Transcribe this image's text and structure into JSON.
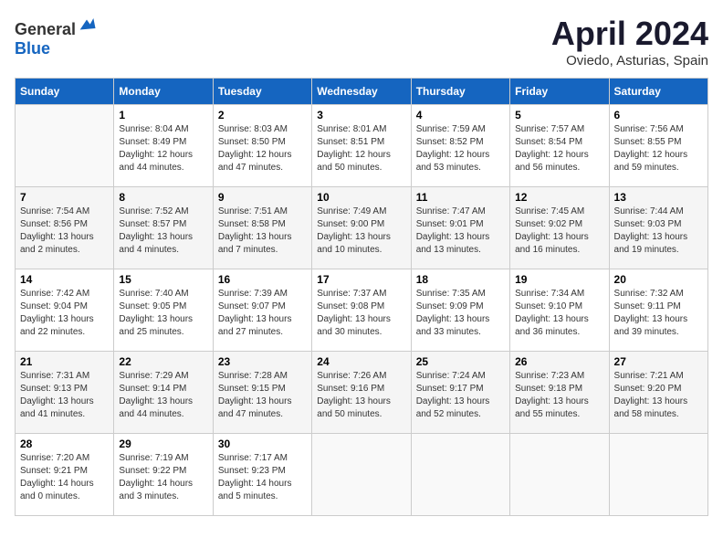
{
  "header": {
    "logo_general": "General",
    "logo_blue": "Blue",
    "title": "April 2024",
    "subtitle": "Oviedo, Asturias, Spain"
  },
  "columns": [
    "Sunday",
    "Monday",
    "Tuesday",
    "Wednesday",
    "Thursday",
    "Friday",
    "Saturday"
  ],
  "weeks": [
    [
      {
        "day": "",
        "info": ""
      },
      {
        "day": "1",
        "info": "Sunrise: 8:04 AM\nSunset: 8:49 PM\nDaylight: 12 hours\nand 44 minutes."
      },
      {
        "day": "2",
        "info": "Sunrise: 8:03 AM\nSunset: 8:50 PM\nDaylight: 12 hours\nand 47 minutes."
      },
      {
        "day": "3",
        "info": "Sunrise: 8:01 AM\nSunset: 8:51 PM\nDaylight: 12 hours\nand 50 minutes."
      },
      {
        "day": "4",
        "info": "Sunrise: 7:59 AM\nSunset: 8:52 PM\nDaylight: 12 hours\nand 53 minutes."
      },
      {
        "day": "5",
        "info": "Sunrise: 7:57 AM\nSunset: 8:54 PM\nDaylight: 12 hours\nand 56 minutes."
      },
      {
        "day": "6",
        "info": "Sunrise: 7:56 AM\nSunset: 8:55 PM\nDaylight: 12 hours\nand 59 minutes."
      }
    ],
    [
      {
        "day": "7",
        "info": "Sunrise: 7:54 AM\nSunset: 8:56 PM\nDaylight: 13 hours\nand 2 minutes."
      },
      {
        "day": "8",
        "info": "Sunrise: 7:52 AM\nSunset: 8:57 PM\nDaylight: 13 hours\nand 4 minutes."
      },
      {
        "day": "9",
        "info": "Sunrise: 7:51 AM\nSunset: 8:58 PM\nDaylight: 13 hours\nand 7 minutes."
      },
      {
        "day": "10",
        "info": "Sunrise: 7:49 AM\nSunset: 9:00 PM\nDaylight: 13 hours\nand 10 minutes."
      },
      {
        "day": "11",
        "info": "Sunrise: 7:47 AM\nSunset: 9:01 PM\nDaylight: 13 hours\nand 13 minutes."
      },
      {
        "day": "12",
        "info": "Sunrise: 7:45 AM\nSunset: 9:02 PM\nDaylight: 13 hours\nand 16 minutes."
      },
      {
        "day": "13",
        "info": "Sunrise: 7:44 AM\nSunset: 9:03 PM\nDaylight: 13 hours\nand 19 minutes."
      }
    ],
    [
      {
        "day": "14",
        "info": "Sunrise: 7:42 AM\nSunset: 9:04 PM\nDaylight: 13 hours\nand 22 minutes."
      },
      {
        "day": "15",
        "info": "Sunrise: 7:40 AM\nSunset: 9:05 PM\nDaylight: 13 hours\nand 25 minutes."
      },
      {
        "day": "16",
        "info": "Sunrise: 7:39 AM\nSunset: 9:07 PM\nDaylight: 13 hours\nand 27 minutes."
      },
      {
        "day": "17",
        "info": "Sunrise: 7:37 AM\nSunset: 9:08 PM\nDaylight: 13 hours\nand 30 minutes."
      },
      {
        "day": "18",
        "info": "Sunrise: 7:35 AM\nSunset: 9:09 PM\nDaylight: 13 hours\nand 33 minutes."
      },
      {
        "day": "19",
        "info": "Sunrise: 7:34 AM\nSunset: 9:10 PM\nDaylight: 13 hours\nand 36 minutes."
      },
      {
        "day": "20",
        "info": "Sunrise: 7:32 AM\nSunset: 9:11 PM\nDaylight: 13 hours\nand 39 minutes."
      }
    ],
    [
      {
        "day": "21",
        "info": "Sunrise: 7:31 AM\nSunset: 9:13 PM\nDaylight: 13 hours\nand 41 minutes."
      },
      {
        "day": "22",
        "info": "Sunrise: 7:29 AM\nSunset: 9:14 PM\nDaylight: 13 hours\nand 44 minutes."
      },
      {
        "day": "23",
        "info": "Sunrise: 7:28 AM\nSunset: 9:15 PM\nDaylight: 13 hours\nand 47 minutes."
      },
      {
        "day": "24",
        "info": "Sunrise: 7:26 AM\nSunset: 9:16 PM\nDaylight: 13 hours\nand 50 minutes."
      },
      {
        "day": "25",
        "info": "Sunrise: 7:24 AM\nSunset: 9:17 PM\nDaylight: 13 hours\nand 52 minutes."
      },
      {
        "day": "26",
        "info": "Sunrise: 7:23 AM\nSunset: 9:18 PM\nDaylight: 13 hours\nand 55 minutes."
      },
      {
        "day": "27",
        "info": "Sunrise: 7:21 AM\nSunset: 9:20 PM\nDaylight: 13 hours\nand 58 minutes."
      }
    ],
    [
      {
        "day": "28",
        "info": "Sunrise: 7:20 AM\nSunset: 9:21 PM\nDaylight: 14 hours\nand 0 minutes."
      },
      {
        "day": "29",
        "info": "Sunrise: 7:19 AM\nSunset: 9:22 PM\nDaylight: 14 hours\nand 3 minutes."
      },
      {
        "day": "30",
        "info": "Sunrise: 7:17 AM\nSunset: 9:23 PM\nDaylight: 14 hours\nand 5 minutes."
      },
      {
        "day": "",
        "info": ""
      },
      {
        "day": "",
        "info": ""
      },
      {
        "day": "",
        "info": ""
      },
      {
        "day": "",
        "info": ""
      }
    ]
  ]
}
